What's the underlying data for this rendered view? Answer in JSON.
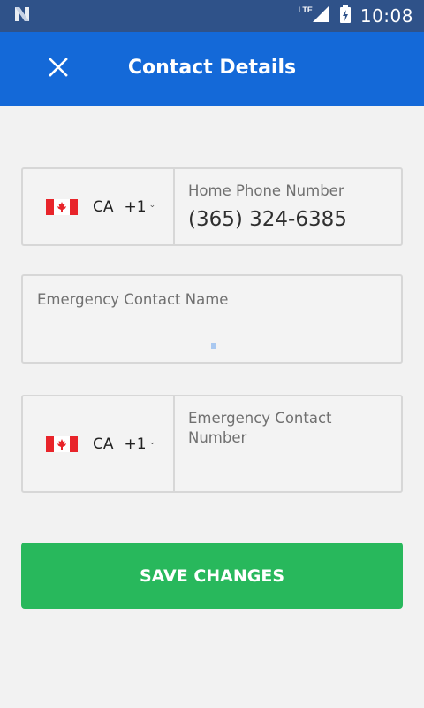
{
  "status_bar": {
    "network": "LTE",
    "time": "10:08",
    "icons": [
      "n-logo-icon",
      "signal-icon",
      "battery-charging-icon"
    ]
  },
  "app_bar": {
    "title": "Contact Details",
    "close_icon": "close-icon"
  },
  "form": {
    "home_phone": {
      "country_code": "CA",
      "dial_code": "+1",
      "label": "Home Phone Number",
      "value": "(365) 324-6385"
    },
    "emergency_contact_name": {
      "label": "Emergency Contact Name",
      "value": ""
    },
    "emergency_contact_number": {
      "country_code": "CA",
      "dial_code": "+1",
      "label": "Emergency Contact Number",
      "value": ""
    }
  },
  "save_button": {
    "label": "SAVE CHANGES",
    "color": "#28b85c"
  },
  "colors": {
    "status_bar": "#2f5289",
    "app_bar": "#1469d8",
    "background": "#f2f2f2"
  }
}
